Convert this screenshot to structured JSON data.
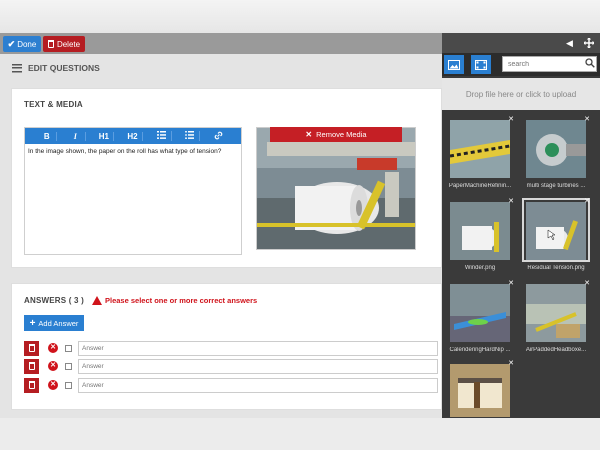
{
  "toolbar": {
    "done_label": "Done",
    "delete_label": "Delete"
  },
  "header": {
    "title": "EDIT QUESTIONS"
  },
  "text_media": {
    "section_label": "TEXT & MEDIA",
    "editor_buttons": [
      "B",
      "I",
      "H1",
      "H2",
      "ordered-list",
      "unordered-list",
      "link"
    ],
    "question_text": "In the image shown, the paper on the roll has what type of tension?",
    "remove_media_label": "Remove Media"
  },
  "answers": {
    "section_label": "ANSWERS ( 3 )",
    "warning": "Please select one or more correct answers",
    "add_label": "Add Answer",
    "placeholder": "Answer",
    "rows": [
      {
        "value": ""
      },
      {
        "value": ""
      },
      {
        "value": ""
      }
    ]
  },
  "panel": {
    "search_placeholder": "search",
    "dropzone_text": "Drop file here or click to upload",
    "files": [
      {
        "name": "PaperMachineRefinin..."
      },
      {
        "name": "multi stage turbines ..."
      },
      {
        "name": "Winder.png"
      },
      {
        "name": "Residual Tension.png"
      },
      {
        "name": "CalenderingHardNip ..."
      },
      {
        "name": "AirPaddedHeadboxe..."
      },
      {
        "name": ""
      }
    ]
  },
  "colors": {
    "primary": "#2a7fd1",
    "danger": "#b51d22",
    "panel": "#3a3a3a"
  }
}
